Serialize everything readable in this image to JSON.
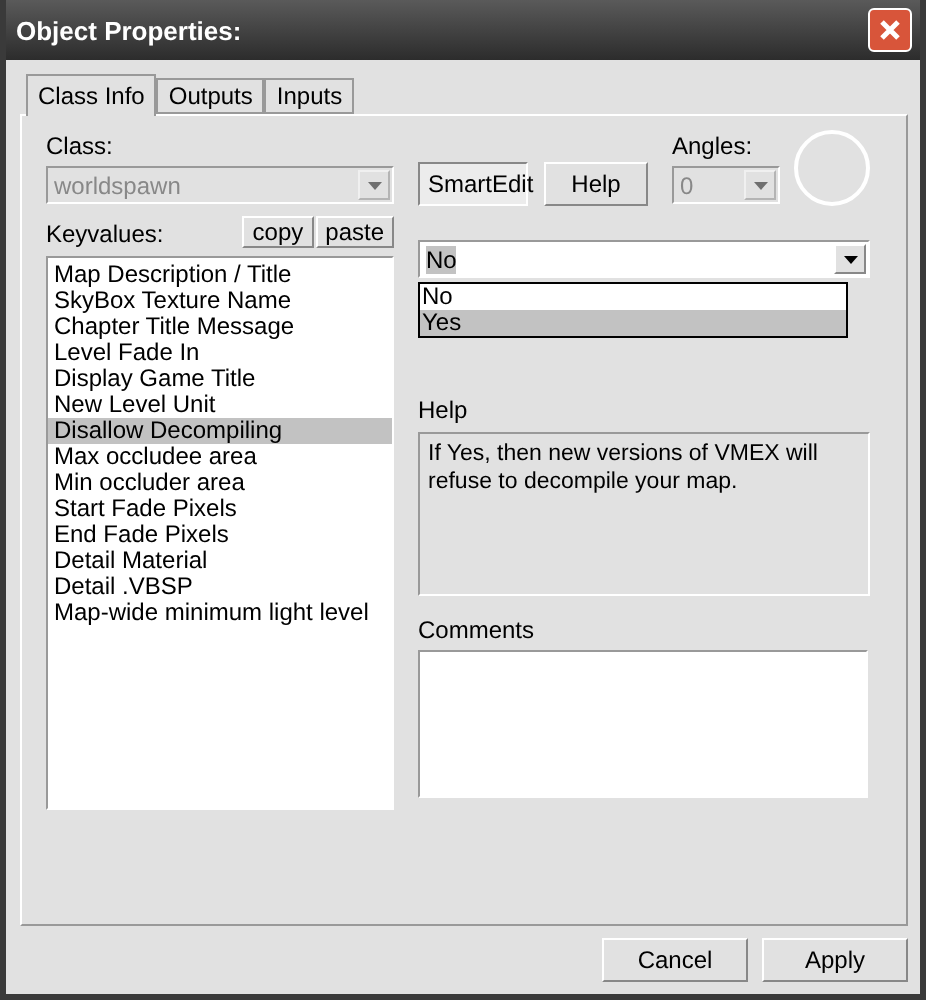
{
  "window": {
    "title": "Object Properties:"
  },
  "tabs": [
    {
      "label": "Class Info",
      "selected": true
    },
    {
      "label": "Outputs",
      "selected": false
    },
    {
      "label": "Inputs",
      "selected": false
    }
  ],
  "class_field": {
    "label": "Class:",
    "value": "worldspawn",
    "disabled": true
  },
  "top_buttons": [
    {
      "label": "SmartEdit",
      "pressed": true
    },
    {
      "label": "Help",
      "pressed": false
    }
  ],
  "angles": {
    "label": "Angles:",
    "value": "0",
    "disabled": true
  },
  "keyvalues": {
    "label": "Keyvalues:",
    "actions": [
      "copy",
      "paste"
    ],
    "items": [
      {
        "label": "Map Description / Title",
        "selected": false
      },
      {
        "label": "SkyBox Texture Name",
        "selected": false
      },
      {
        "label": "Chapter Title Message",
        "selected": false
      },
      {
        "label": "Level Fade In",
        "selected": false
      },
      {
        "label": "Display Game Title",
        "selected": false
      },
      {
        "label": "New Level Unit",
        "selected": false
      },
      {
        "label": "Disallow Decompiling",
        "selected": true
      },
      {
        "label": "Max occludee area",
        "selected": false
      },
      {
        "label": "Min occluder area",
        "selected": false
      },
      {
        "label": "Start Fade Pixels",
        "selected": false
      },
      {
        "label": "End Fade Pixels",
        "selected": false
      },
      {
        "label": "Detail Material",
        "selected": false
      },
      {
        "label": "Detail .VBSP",
        "selected": false
      },
      {
        "label": "Map-wide minimum light level",
        "selected": false
      }
    ]
  },
  "value_field": {
    "value": "No",
    "expanded": true,
    "options": [
      {
        "label": "No",
        "highlighted": false
      },
      {
        "label": "Yes",
        "highlighted": true
      }
    ]
  },
  "help": {
    "label": "Help",
    "text": "If Yes, then new versions of VMEX will refuse to decompile your map."
  },
  "comments": {
    "label": "Comments"
  },
  "footer_buttons": [
    "Cancel",
    "Apply"
  ]
}
